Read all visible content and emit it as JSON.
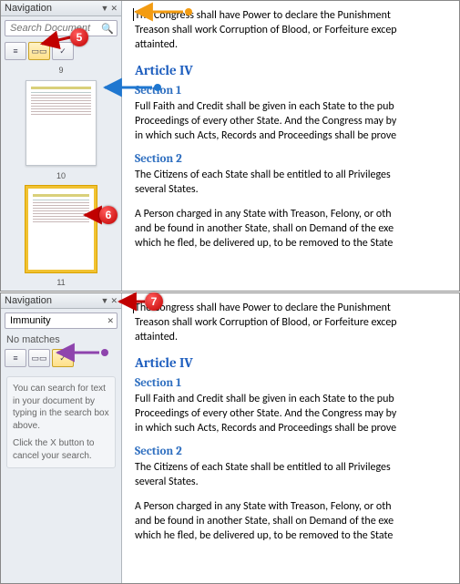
{
  "nav": {
    "title": "Navigation",
    "search_placeholder": "Search Document",
    "search_value_2": "Immunity",
    "no_matches": "No matches",
    "hint1": "You can search for text in your document by typing in the search box above.",
    "hint2": "Click the X button to cancel your search.",
    "tabs": {
      "headings": "≡",
      "pages": "▭▭",
      "results": "✓"
    },
    "pages": {
      "p9": "9",
      "p10": "10",
      "p11": "11"
    }
  },
  "doc": {
    "p1": "The Congress shall have Power to declare the Punishment",
    "p2": "Treason shall work Corruption of Blood, or Forfeiture excep",
    "p3": "attainted.",
    "article": "Article IV",
    "s1": "Section 1",
    "s1p": "Full Faith and Credit shall be given in each State to the pub",
    "s1p2": "Proceedings of every other State. And the Congress may by",
    "s1p3": "in which such Acts, Records and Proceedings shall be prove",
    "s2": "Section 2",
    "s2p": "The Citizens of each State shall be entitled to all Privileges",
    "s2p2": "several States.",
    "s2p3": "A Person charged in any State with Treason, Felony, or oth",
    "s2p4": "and be found in another State, shall on Demand of the exe",
    "s2p5": "which he fled, be delivered up, to be removed to the State"
  },
  "callouts": {
    "c5": "5",
    "c6": "6",
    "c7": "7"
  }
}
